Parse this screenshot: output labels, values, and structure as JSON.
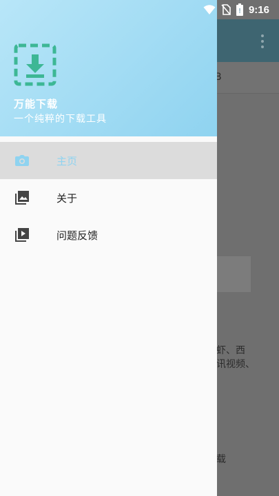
{
  "status_bar": {
    "time": "9:16",
    "icons": [
      "wifi-icon",
      "no-sim-icon",
      "battery-icon"
    ]
  },
  "drawer": {
    "app_name": "万能下载",
    "app_subtitle": "一个纯粹的下载工具",
    "logo_icon": "download-box-icon",
    "items": [
      {
        "label": "主页",
        "icon": "camera-icon",
        "active": true
      },
      {
        "label": "关于",
        "icon": "photo-library-icon",
        "active": false
      },
      {
        "label": "问题反馈",
        "icon": "video-library-icon",
        "active": false
      }
    ]
  },
  "background": {
    "peek_texts": [
      "B",
      "虾、西",
      "讯视频、",
      "载"
    ]
  },
  "colors": {
    "header_start": "#b8e6f8",
    "header_end": "#8fd3f0",
    "logo": "#3db795",
    "active_label": "#8fd3f0"
  }
}
